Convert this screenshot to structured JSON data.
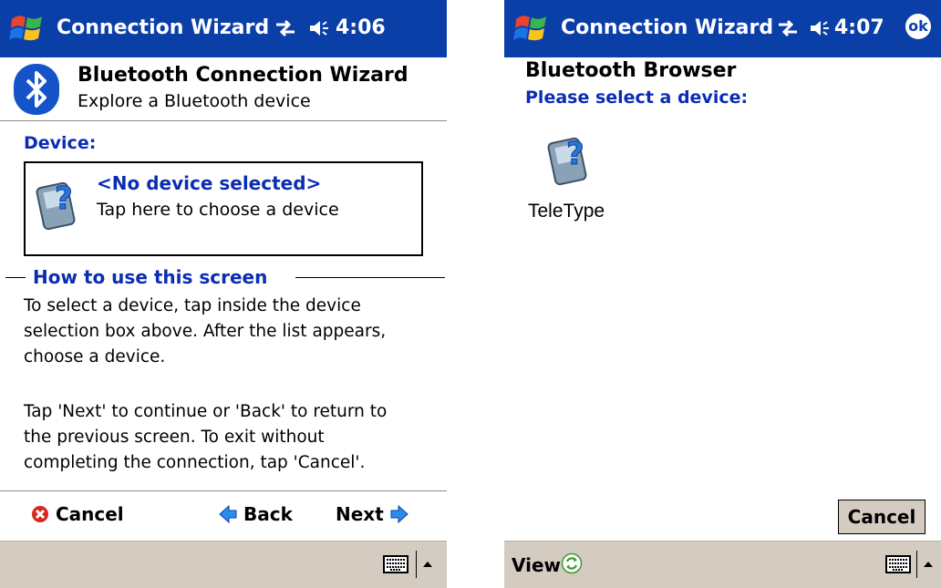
{
  "colors": {
    "titlebar": "#0b3fa8",
    "accent_text": "#0b2db4",
    "menubar": "#d4ccc1"
  },
  "left": {
    "titlebar": {
      "title": "Connection Wizard",
      "time": "4:06",
      "icons": [
        "windows-flag-icon",
        "connectivity-icon",
        "speaker-icon"
      ]
    },
    "header": {
      "title": "Bluetooth Connection Wizard",
      "subtitle": "Explore a Bluetooth device",
      "icon": "bluetooth-icon"
    },
    "device": {
      "label": "Device:",
      "name": "<No device selected>",
      "hint": "Tap here to choose a device",
      "icon": "unknown-device-icon"
    },
    "howto": {
      "title": "How to use this screen",
      "paragraphs": [
        [
          "To select a device, tap inside the device",
          "selection box above. After the list appears,",
          "choose a device."
        ],
        [
          "Tap 'Next' to continue or 'Back' to return to",
          "the previous screen. To exit without",
          "completing the connection, tap 'Cancel'."
        ]
      ]
    },
    "toolbar": {
      "cancel": "Cancel",
      "back": "Back",
      "next": "Next"
    }
  },
  "right": {
    "titlebar": {
      "title": "Connection Wizard",
      "time": "4:07",
      "ok": "ok"
    },
    "browser": {
      "title": "Bluetooth Browser",
      "subtitle": "Please select a device:",
      "devices": [
        {
          "name": "TeleType",
          "icon": "unknown-device-icon"
        }
      ]
    },
    "cancel_button": "Cancel",
    "menubar": {
      "view": "View"
    }
  }
}
